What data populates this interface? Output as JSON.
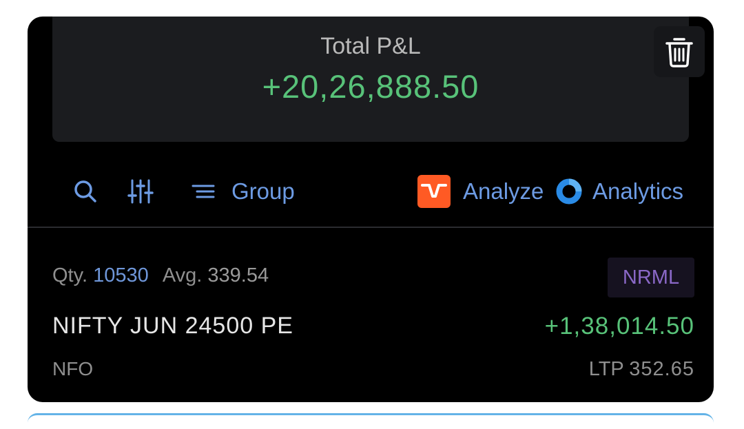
{
  "summary": {
    "label": "Total P&L",
    "value": "+20,26,888.50"
  },
  "toolbar": {
    "group_label": "Group",
    "analyze_label": "Analyze",
    "analytics_label": "Analytics"
  },
  "position": {
    "qty_label": "Qty.",
    "qty": "10530",
    "avg_label": "Avg.",
    "avg": "339.54",
    "product": "NRML",
    "instrument": "NIFTY JUN 24500 PE",
    "pnl": "+1,38,014.50",
    "exchange": "NFO",
    "ltp_label": "LTP",
    "ltp": "352.65"
  },
  "colors": {
    "profit": "#58c279",
    "accent": "#6d9be3",
    "analyze_brand": "#ff5a24",
    "analytics_brand": "#2a8be6",
    "product_badge": "#8a68c7"
  },
  "icons": {
    "search": "search-icon",
    "filter": "filter-sliders-icon",
    "group": "group-lines-icon",
    "analyze": "analyze-logo-icon",
    "analytics": "analytics-ring-icon",
    "delete": "trash-icon"
  }
}
